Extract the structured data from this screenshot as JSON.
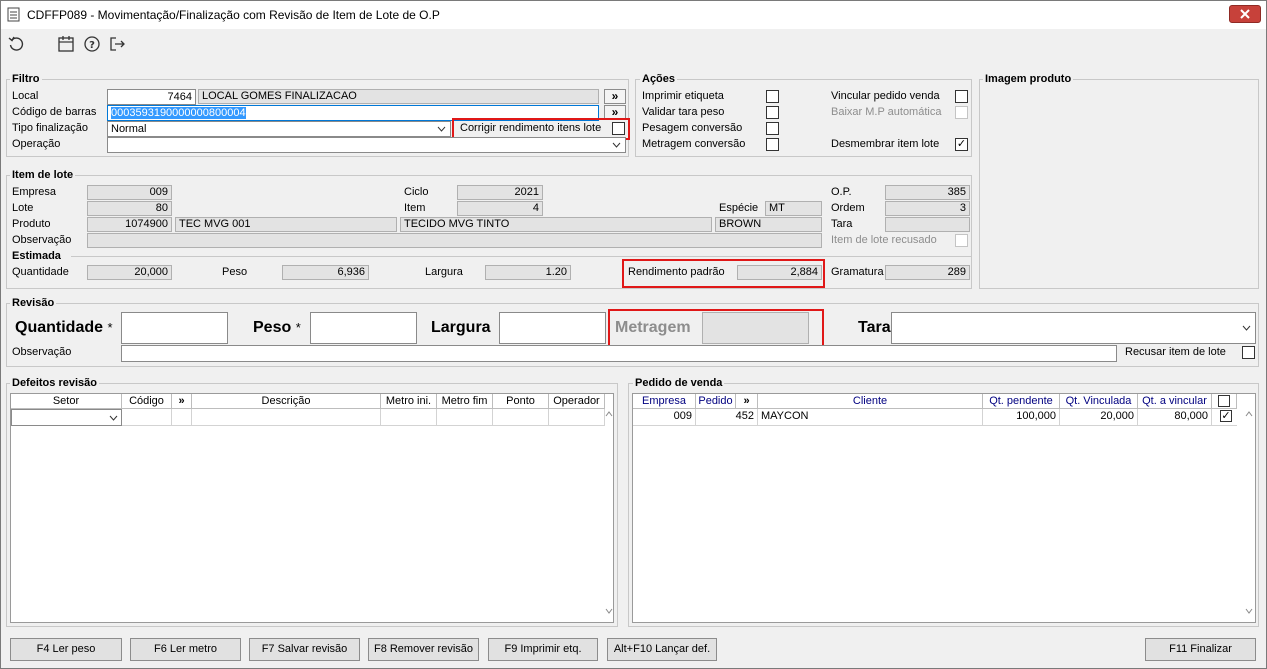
{
  "window": {
    "title": "CDFFP089 - Movimentação/Finalização com Revisão de Item de Lote de O.P"
  },
  "toolbar": {
    "icons": [
      "refresh-icon",
      "calendar-icon",
      "help-icon",
      "exit-icon"
    ]
  },
  "filtro": {
    "title": "Filtro",
    "local_label": "Local",
    "local_code": "7464",
    "local_name": "LOCAL GOMES FINALIZACAO",
    "barcode_label": "Código de barras",
    "barcode_value": "0003593190000000800004",
    "tipo_label": "Tipo finalização",
    "tipo_value": "Normal",
    "corrigir_label": "Corrigir rendimento itens lote",
    "operacao_label": "Operação",
    "operacao_value": "",
    "more_glyph": "»"
  },
  "acoes": {
    "title": "Ações",
    "imprimir_etiqueta": "Imprimir etiqueta",
    "validar_tara": "Validar tara peso",
    "pesagem_conversao": "Pesagem conversão",
    "metragem_conversao": "Metragem conversão",
    "vincular_pedido": "Vincular pedido venda",
    "baixar_mp": "Baixar M.P automática",
    "desmembrar": "Desmembrar item lote",
    "desmembrar_checked": "✓"
  },
  "imagem": {
    "title": "Imagem produto"
  },
  "item_lote": {
    "title": "Item de lote",
    "empresa_label": "Empresa",
    "empresa": "009",
    "lote_label": "Lote",
    "lote": "80",
    "produto_label": "Produto",
    "produto_code": "1074900",
    "produto_name": "TEC MVG 001",
    "produto_desc": "TECIDO MVG TINTO",
    "produto_cor": "BROWN",
    "observacao_label": "Observação",
    "ciclo_label": "Ciclo",
    "ciclo": "2021",
    "item_label": "Item",
    "item": "4",
    "especie_label": "Espécie",
    "especie": "MT",
    "op_label": "O.P.",
    "op": "385",
    "ordem_label": "Ordem",
    "ordem": "3",
    "tara_label": "Tara",
    "tara": "",
    "recusado_label": "Item de lote recusado"
  },
  "estimada": {
    "title": "Estimada",
    "quantidade_label": "Quantidade",
    "quantidade": "20,000",
    "peso_label": "Peso",
    "peso": "6,936",
    "largura_label": "Largura",
    "largura": "1.20",
    "rendimento_label": "Rendimento padrão",
    "rendimento": "2,884",
    "gramatura_label": "Gramatura",
    "gramatura": "289"
  },
  "revisao": {
    "title": "Revisão",
    "quantidade_label": "Quantidade",
    "peso_label": "Peso",
    "largura_label": "Largura",
    "metragem_label": "Metragem",
    "tara_label": "Tara",
    "required_mark": "*",
    "observacao_label": "Observação",
    "recusar_label": "Recusar item de lote"
  },
  "defeitos": {
    "title": "Defeitos revisão",
    "columns": [
      "Setor",
      "Código",
      "»",
      "Descrição",
      "Metro ini.",
      "Metro fim",
      "Ponto",
      "Operador"
    ]
  },
  "pedido": {
    "title": "Pedido de venda",
    "columns": [
      "Empresa",
      "Pedido",
      "»",
      "Cliente",
      "Qt. pendente",
      "Qt. Vinculada",
      "Qt. a vincular"
    ],
    "rows": [
      {
        "empresa": "009",
        "pedido": "452",
        "cliente": "MAYCON",
        "qt_pendente": "100,000",
        "qt_vinculada": "20,000",
        "qt_vincular": "80,000",
        "checked": "✓"
      }
    ]
  },
  "footer": {
    "f4": "F4 Ler peso",
    "f6": "F6 Ler metro",
    "f7": "F7 Salvar revisão",
    "f8": "F8 Remover revisão",
    "f9": "F9 Imprimir etq.",
    "altf10": "Alt+F10 Lançar def.",
    "f11": "F11 Finalizar"
  },
  "colors": {
    "highlight_box": "#e01818",
    "close_button": "#c7413a",
    "selection": "#3399ff",
    "header_blue": "#000080"
  }
}
